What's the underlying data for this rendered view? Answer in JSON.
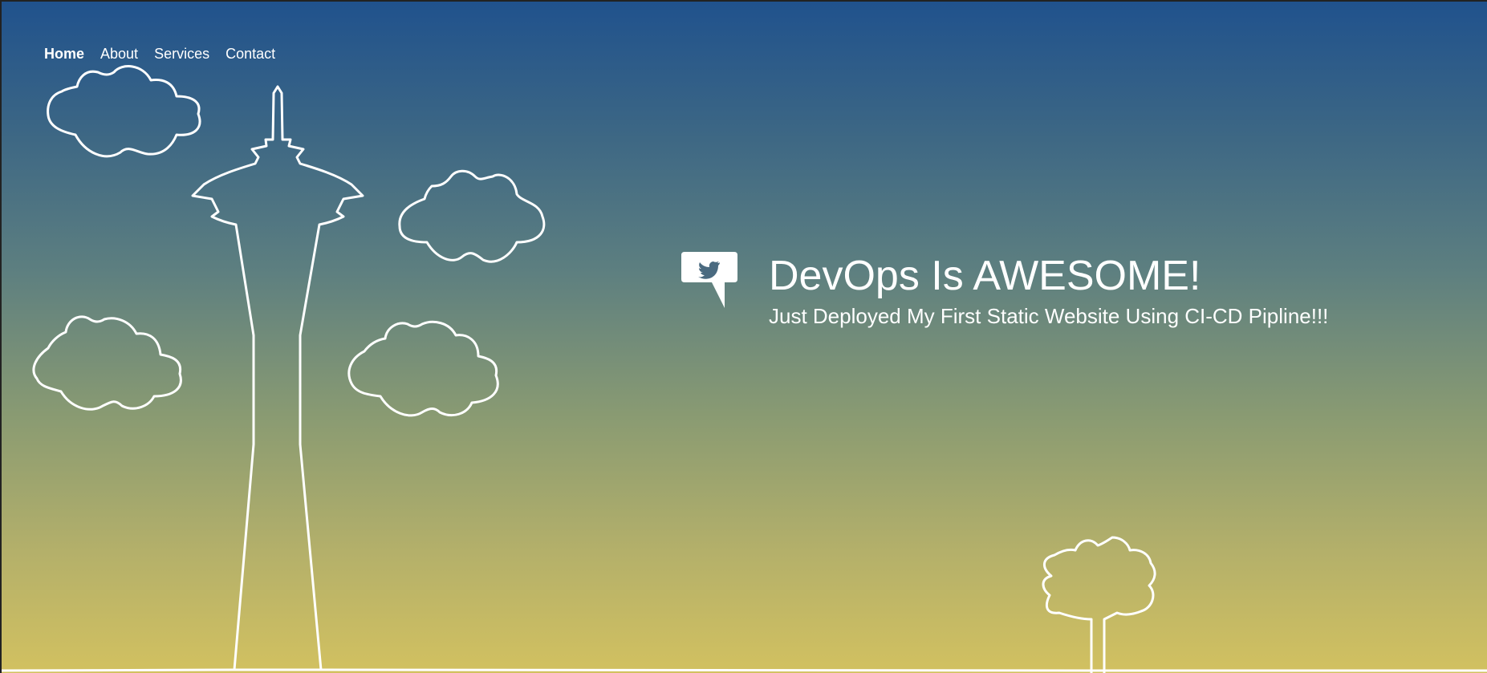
{
  "nav": {
    "items": [
      {
        "label": "Home",
        "active": true
      },
      {
        "label": "About",
        "active": false
      },
      {
        "label": "Services",
        "active": false
      },
      {
        "label": "Contact",
        "active": false
      }
    ]
  },
  "hero": {
    "icon": "twitter-bird-speech-bubble-icon",
    "title": "DevOps Is AWESOME!",
    "subtitle": "Just Deployed My First Static Website Using CI-CD Pipline!!!"
  },
  "theme": {
    "gradient_top": "#20528d",
    "gradient_bottom": "#d2c160",
    "line_color": "#ffffff",
    "text_color": "#ffffff"
  }
}
